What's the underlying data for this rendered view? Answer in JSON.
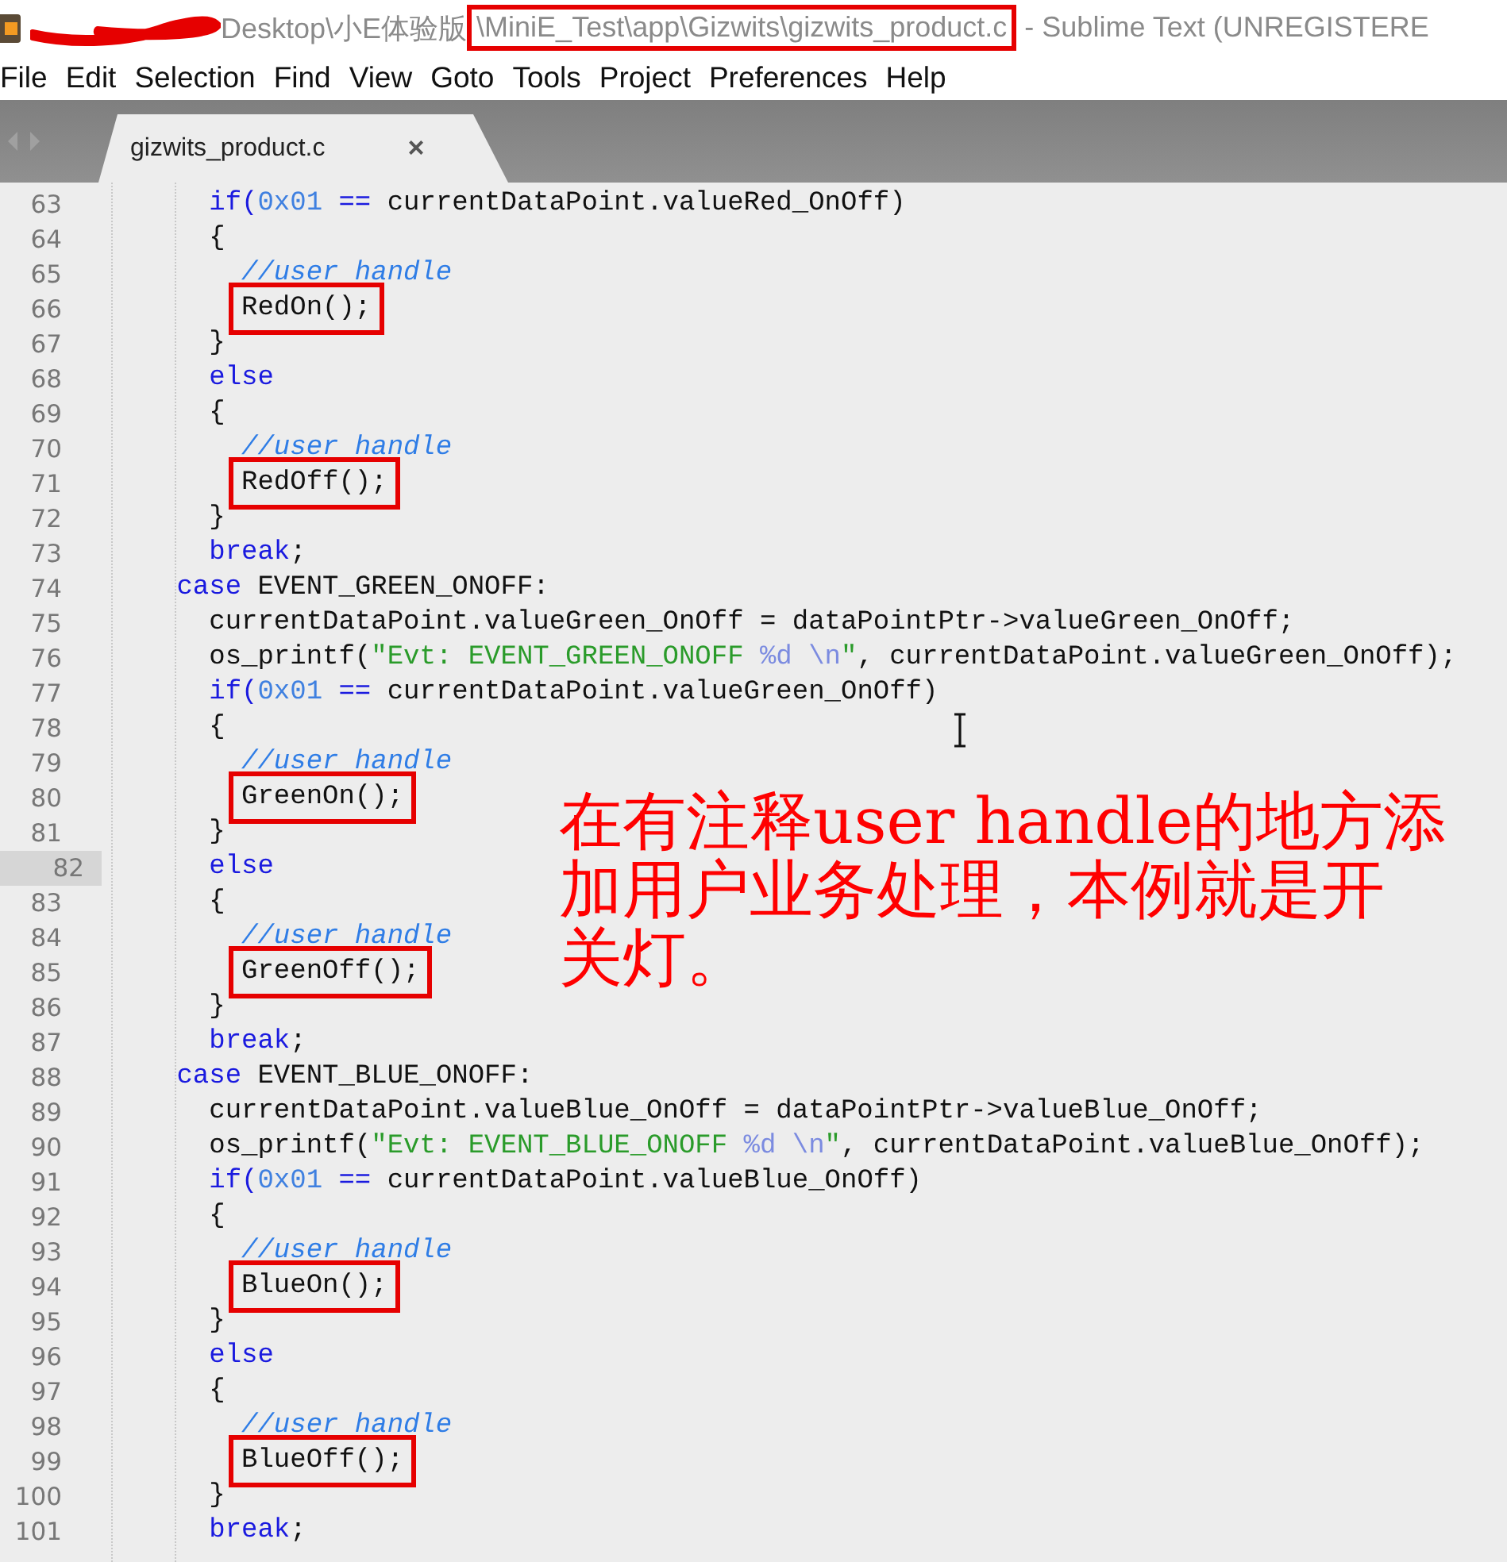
{
  "window": {
    "title": [
      {
        "kind": "redaction"
      },
      {
        "kind": "plain",
        "text": "Desktop\\小E体验版"
      },
      {
        "kind": "boxed",
        "text": "\\MiniE_Test\\app\\Gizwits\\gizwits_product.c"
      },
      {
        "kind": "plain",
        "text": " - Sublime Text (UNREGISTERE"
      }
    ]
  },
  "menu": [
    "File",
    "Edit",
    "Selection",
    "Find",
    "View",
    "Goto",
    "Tools",
    "Project",
    "Preferences",
    "Help"
  ],
  "tabs": [
    {
      "label": "gizwits_product.c",
      "close": "×",
      "selected": true
    }
  ],
  "editor": {
    "lines": [
      {
        "number": "63",
        "current": false,
        "tokens": [
          {
            "kind": "keyword",
            "text": "        if("
          },
          {
            "kind": "number",
            "text": "0x01"
          },
          {
            "kind": "keyword",
            "text": " =="
          },
          {
            "kind": "plain",
            "text": " currentDataPoint.valueRed_OnOff)"
          }
        ]
      },
      {
        "number": "64",
        "current": false,
        "tokens": [
          {
            "kind": "plain",
            "text": "        {"
          }
        ]
      },
      {
        "number": "65",
        "current": false,
        "tokens": [
          {
            "kind": "comment",
            "text": "          //user handle"
          }
        ]
      },
      {
        "number": "66",
        "current": false,
        "tokens": [
          {
            "kind": "boxed",
            "text": "RedOn();"
          }
        ]
      },
      {
        "number": "67",
        "current": false,
        "tokens": [
          {
            "kind": "plain",
            "text": "        }"
          }
        ]
      },
      {
        "number": "68",
        "current": false,
        "tokens": [
          {
            "kind": "keyword",
            "text": "        else"
          }
        ]
      },
      {
        "number": "69",
        "current": false,
        "tokens": [
          {
            "kind": "plain",
            "text": "        {"
          }
        ]
      },
      {
        "number": "70",
        "current": false,
        "tokens": [
          {
            "kind": "comment",
            "text": "          //user handle"
          }
        ]
      },
      {
        "number": "71",
        "current": false,
        "tokens": [
          {
            "kind": "boxed",
            "text": "RedOff();"
          }
        ]
      },
      {
        "number": "72",
        "current": false,
        "tokens": [
          {
            "kind": "plain",
            "text": "        }"
          }
        ]
      },
      {
        "number": "73",
        "current": false,
        "tokens": [
          {
            "kind": "keyword",
            "text": "        break"
          },
          {
            "kind": "plain",
            "text": ";"
          }
        ]
      },
      {
        "number": "74",
        "current": false,
        "tokens": [
          {
            "kind": "keyword",
            "text": "      case"
          },
          {
            "kind": "plain",
            "text": " EVENT_GREEN_ONOFF:"
          }
        ]
      },
      {
        "number": "75",
        "current": false,
        "tokens": [
          {
            "kind": "plain",
            "text": "        currentDataPoint.valueGreen_OnOff = dataPointPtr->valueGreen_OnOff;"
          }
        ]
      },
      {
        "number": "76",
        "current": false,
        "tokens": [
          {
            "kind": "plain",
            "text": "        os_printf("
          },
          {
            "kind": "string",
            "text": "\"Evt: EVENT_GREEN_ONOFF "
          },
          {
            "kind": "escape",
            "text": "%d \\n"
          },
          {
            "kind": "string",
            "text": "\""
          },
          {
            "kind": "plain",
            "text": ", currentDataPoint.valueGreen_OnOff);"
          }
        ]
      },
      {
        "number": "77",
        "current": false,
        "tokens": [
          {
            "kind": "keyword",
            "text": "        if("
          },
          {
            "kind": "number",
            "text": "0x01"
          },
          {
            "kind": "keyword",
            "text": " =="
          },
          {
            "kind": "plain",
            "text": " currentDataPoint.valueGreen_OnOff)"
          }
        ]
      },
      {
        "number": "78",
        "current": false,
        "tokens": [
          {
            "kind": "plain",
            "text": "        {"
          }
        ]
      },
      {
        "number": "79",
        "current": false,
        "tokens": [
          {
            "kind": "comment",
            "text": "          //user handle"
          }
        ]
      },
      {
        "number": "80",
        "current": false,
        "tokens": [
          {
            "kind": "boxed",
            "text": "GreenOn();"
          }
        ]
      },
      {
        "number": "81",
        "current": false,
        "tokens": [
          {
            "kind": "plain",
            "text": "        }"
          }
        ]
      },
      {
        "number": "82",
        "current": true,
        "tokens": [
          {
            "kind": "keyword",
            "text": "        else"
          }
        ]
      },
      {
        "number": "83",
        "current": false,
        "tokens": [
          {
            "kind": "plain",
            "text": "        {"
          }
        ]
      },
      {
        "number": "84",
        "current": false,
        "tokens": [
          {
            "kind": "comment",
            "text": "          //user handle"
          }
        ]
      },
      {
        "number": "85",
        "current": false,
        "tokens": [
          {
            "kind": "boxed",
            "text": "GreenOff();"
          }
        ]
      },
      {
        "number": "86",
        "current": false,
        "tokens": [
          {
            "kind": "plain",
            "text": "        }"
          }
        ]
      },
      {
        "number": "87",
        "current": false,
        "tokens": [
          {
            "kind": "keyword",
            "text": "        break"
          },
          {
            "kind": "plain",
            "text": ";"
          }
        ]
      },
      {
        "number": "88",
        "current": false,
        "tokens": [
          {
            "kind": "keyword",
            "text": "      case"
          },
          {
            "kind": "plain",
            "text": " EVENT_BLUE_ONOFF:"
          }
        ]
      },
      {
        "number": "89",
        "current": false,
        "tokens": [
          {
            "kind": "plain",
            "text": "        currentDataPoint.valueBlue_OnOff = dataPointPtr->valueBlue_OnOff;"
          }
        ]
      },
      {
        "number": "90",
        "current": false,
        "tokens": [
          {
            "kind": "plain",
            "text": "        os_printf("
          },
          {
            "kind": "string",
            "text": "\"Evt: EVENT_BLUE_ONOFF "
          },
          {
            "kind": "escape",
            "text": "%d \\n"
          },
          {
            "kind": "string",
            "text": "\""
          },
          {
            "kind": "plain",
            "text": ", currentDataPoint.valueBlue_OnOff);"
          }
        ]
      },
      {
        "number": "91",
        "current": false,
        "tokens": [
          {
            "kind": "keyword",
            "text": "        if("
          },
          {
            "kind": "number",
            "text": "0x01"
          },
          {
            "kind": "keyword",
            "text": " =="
          },
          {
            "kind": "plain",
            "text": " currentDataPoint.valueBlue_OnOff)"
          }
        ]
      },
      {
        "number": "92",
        "current": false,
        "tokens": [
          {
            "kind": "plain",
            "text": "        {"
          }
        ]
      },
      {
        "number": "93",
        "current": false,
        "tokens": [
          {
            "kind": "comment",
            "text": "          //user handle"
          }
        ]
      },
      {
        "number": "94",
        "current": false,
        "tokens": [
          {
            "kind": "boxed",
            "text": "BlueOn();"
          }
        ]
      },
      {
        "number": "95",
        "current": false,
        "tokens": [
          {
            "kind": "plain",
            "text": "        }"
          }
        ]
      },
      {
        "number": "96",
        "current": false,
        "tokens": [
          {
            "kind": "keyword",
            "text": "        else"
          }
        ]
      },
      {
        "number": "97",
        "current": false,
        "tokens": [
          {
            "kind": "plain",
            "text": "        {"
          }
        ]
      },
      {
        "number": "98",
        "current": false,
        "tokens": [
          {
            "kind": "comment",
            "text": "          //user handle"
          }
        ]
      },
      {
        "number": "99",
        "current": false,
        "tokens": [
          {
            "kind": "boxed",
            "text": "BlueOff();"
          }
        ]
      },
      {
        "number": "100",
        "current": false,
        "tokens": [
          {
            "kind": "plain",
            "text": "        }"
          }
        ]
      },
      {
        "number": "101",
        "current": false,
        "tokens": [
          {
            "kind": "keyword",
            "text": "        break"
          },
          {
            "kind": "plain",
            "text": ";"
          }
        ]
      }
    ]
  },
  "annotation": {
    "lines": [
      "在有注释user handle的地方添",
      "加用户业务处理，本例就是开",
      "关灯。"
    ]
  }
}
